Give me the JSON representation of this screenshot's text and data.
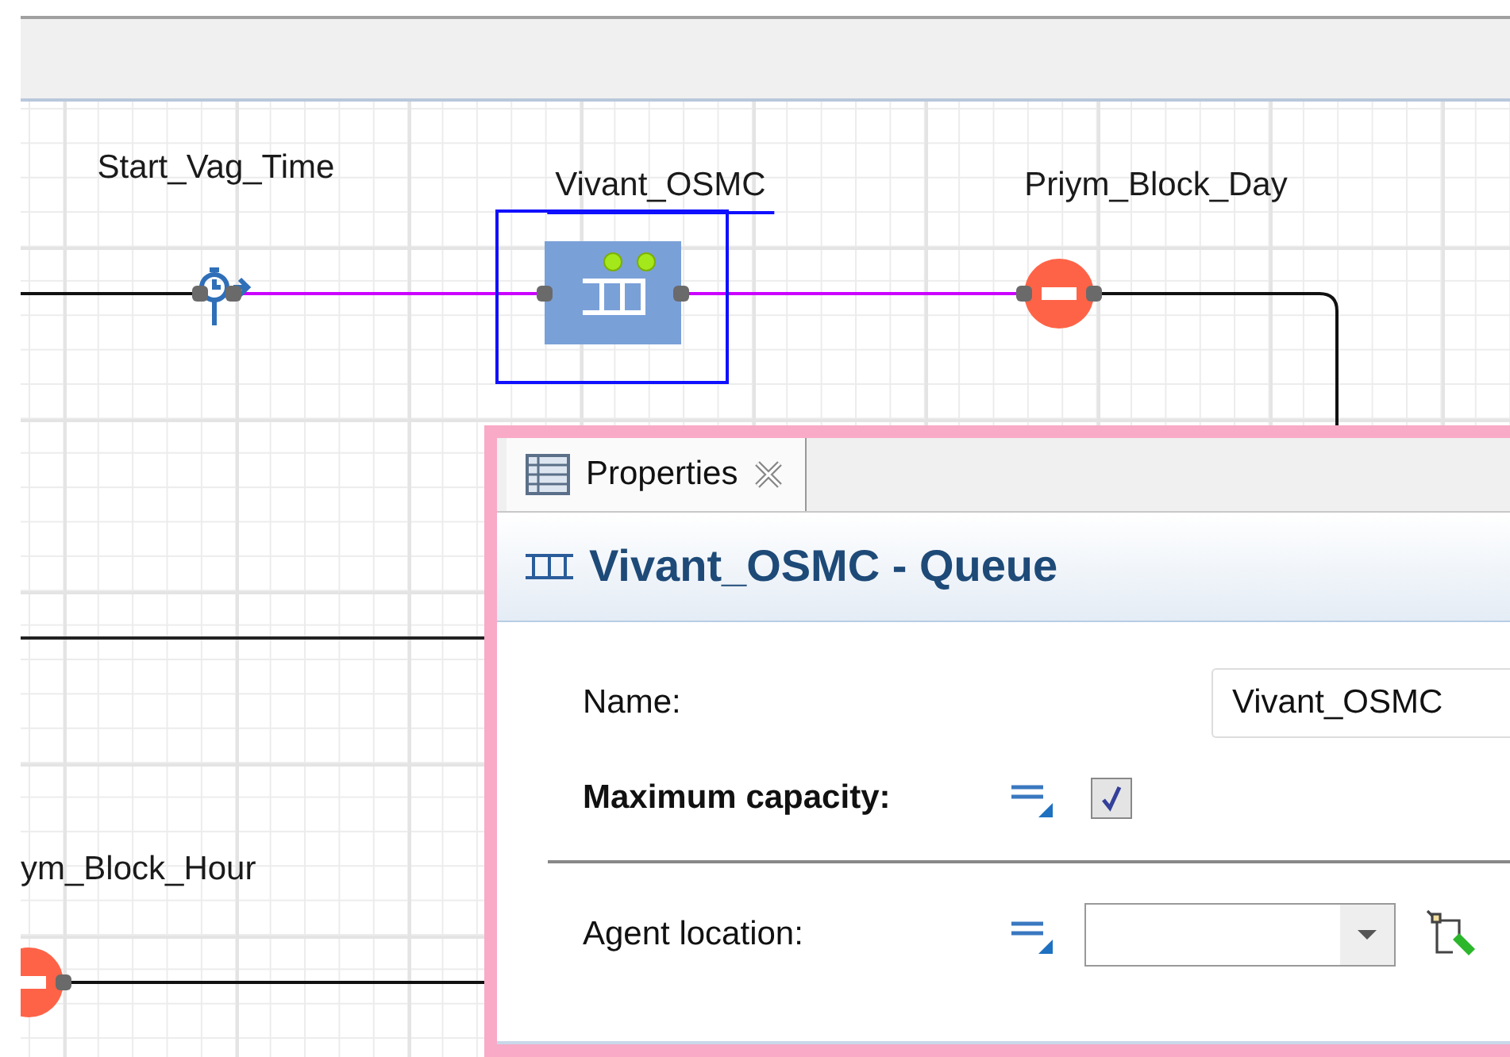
{
  "diagram": {
    "nodes": [
      {
        "kind": "time",
        "label": "Start_Vag_Time",
        "selected": false
      },
      {
        "kind": "queue",
        "label": "Vivant_OSMC",
        "selected": true
      },
      {
        "kind": "block",
        "label": "Priym_Block_Day",
        "selected": false
      },
      {
        "kind": "block",
        "label": "ym_Block_Hour",
        "selected": false
      }
    ]
  },
  "properties": {
    "tab": {
      "label": "Properties",
      "selected": true
    },
    "title": "Vivant_OSMC - Queue",
    "sections": [
      [
        {
          "kind": "text",
          "label": "Name:",
          "value": "Vivant_OSMC",
          "emphasized": false
        },
        {
          "kind": "checkbox",
          "label": "Maximum capacity:",
          "checked": true,
          "emphasized": true
        }
      ],
      [
        {
          "kind": "dropdown",
          "label": "Agent location:",
          "emphasized": false
        }
      ]
    ]
  }
}
